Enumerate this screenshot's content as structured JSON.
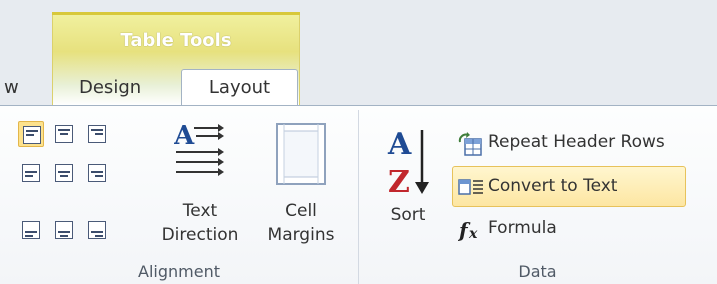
{
  "contextual_tab": {
    "title": "Table Tools"
  },
  "tabs": [
    {
      "label": "w",
      "active": false
    },
    {
      "label": "Design",
      "active": false
    },
    {
      "label": "Layout",
      "active": true
    }
  ],
  "groups": {
    "alignment": {
      "label": "Alignment",
      "text_direction": {
        "line1": "Text",
        "line2": "Direction"
      },
      "cell_margins": {
        "line1": "Cell",
        "line2": "Margins"
      },
      "buttons": [
        "align-top-left",
        "align-top-center",
        "align-top-right",
        "align-center-left",
        "align-center",
        "align-center-right",
        "align-bottom-left",
        "align-bottom-center",
        "align-bottom-right"
      ],
      "selected": "align-top-left"
    },
    "data": {
      "label": "Data",
      "sort": {
        "label": "Sort"
      },
      "repeat_header_rows": {
        "label": "Repeat Header Rows"
      },
      "convert_to_text": {
        "label": "Convert to Text",
        "highlighted": true
      },
      "formula": {
        "label": "Formula"
      }
    }
  },
  "colors": {
    "contextual_yellow": "#e7e17e",
    "highlight": "#fde6a2",
    "border": "#a3b3c4"
  }
}
